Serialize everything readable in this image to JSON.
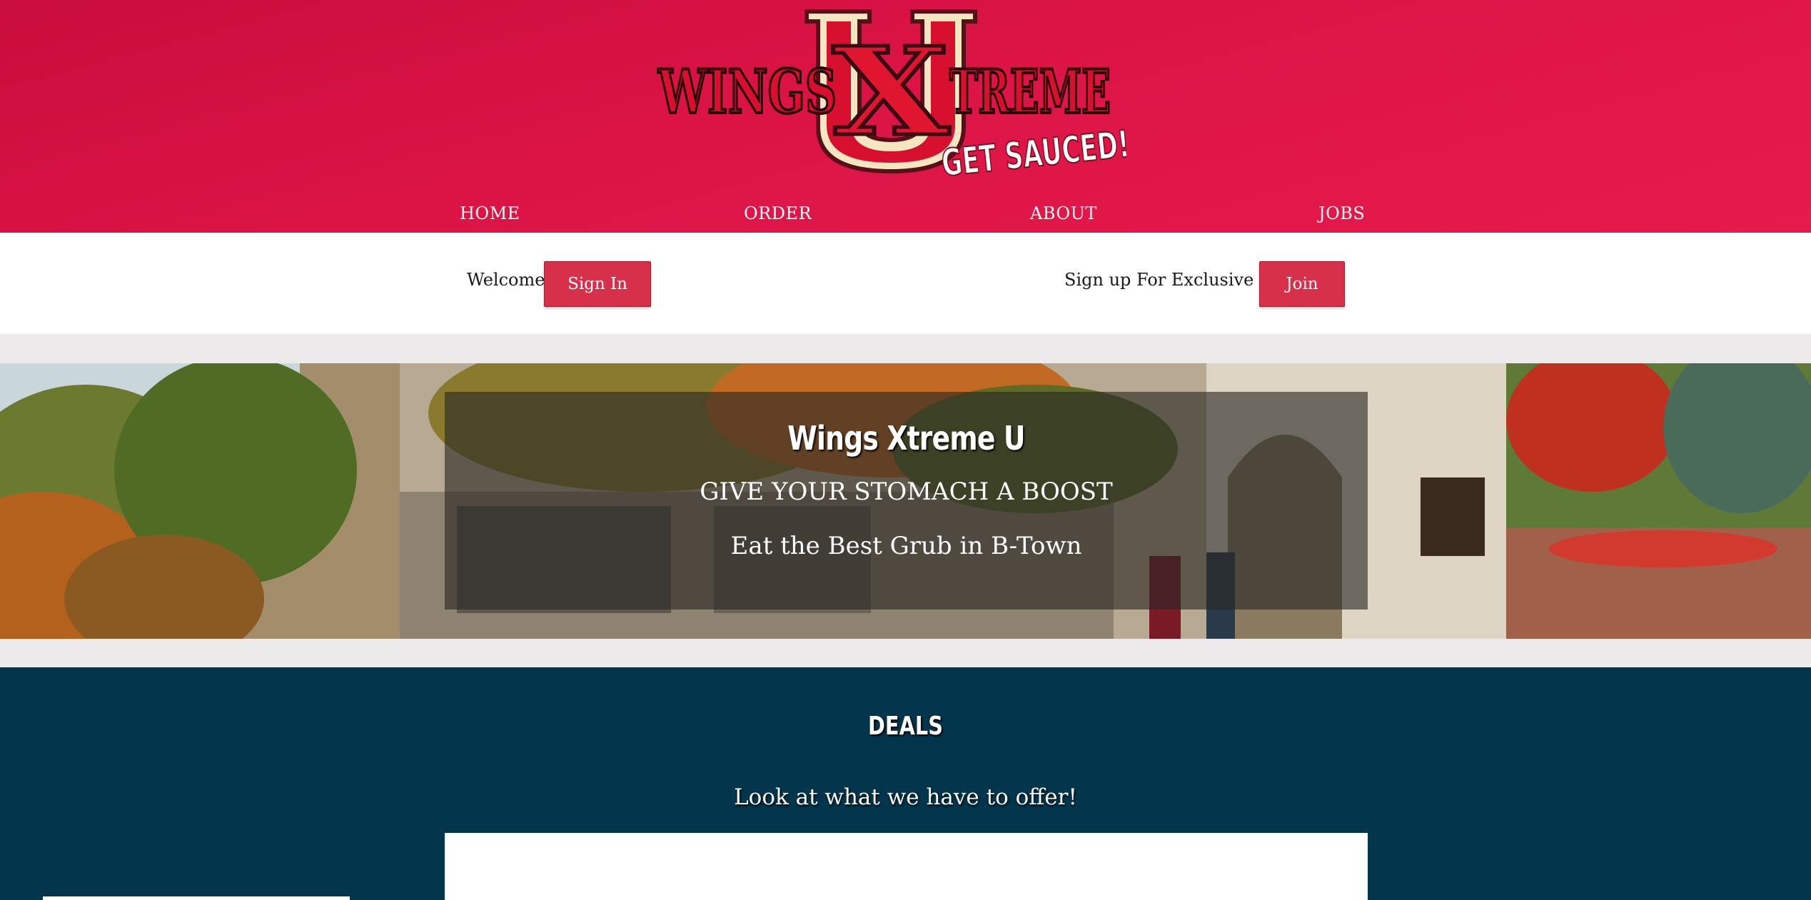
{
  "logo": {
    "word_left": "WINGS",
    "letter_x": "X",
    "word_right": "TREME",
    "letter_u": "U",
    "tagline": "GET SAUCED!",
    "colors": {
      "red": "#d8102f",
      "cream": "#f4e6c0",
      "dark": "#3a0a12"
    }
  },
  "nav": {
    "items": [
      {
        "label": "HOME"
      },
      {
        "label": "ORDER"
      },
      {
        "label": "ABOUT"
      },
      {
        "label": "JOBS"
      }
    ]
  },
  "welcome_bar": {
    "welcome_text": "Welcome!",
    "sign_in_label": "Sign In",
    "signup_text": "Sign up For Exclusive Deals",
    "join_label": "Join"
  },
  "hero": {
    "title": "Wings Xtreme U",
    "line1": "GIVE YOUR STOMACH A BOOST",
    "line2": "Eat the Best Grub in B-Town"
  },
  "deals": {
    "title": "DEALS",
    "subtitle": "Look at what we have to offer!"
  },
  "colors": {
    "header_red": "#dc1446",
    "button_red": "#d6304a",
    "deals_navy": "#03364d",
    "page_gray": "#eceaea"
  }
}
